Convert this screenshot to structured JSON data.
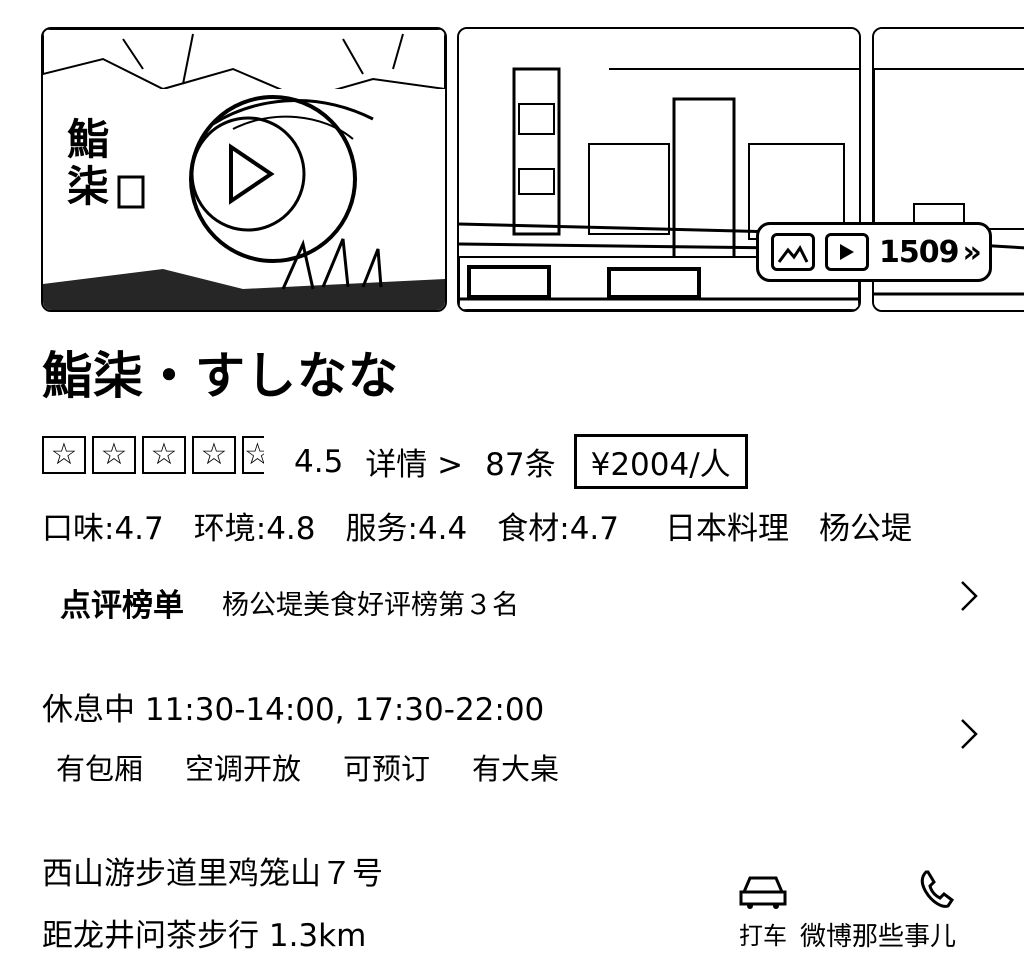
{
  "gallery": {
    "photo1_sign_text": "鮨柒",
    "media_count": "1509",
    "icons": [
      "image-icon",
      "video-icon",
      "chevron-right-icon",
      "play-icon"
    ]
  },
  "restaurant": {
    "name": "鮨柒・すしなな",
    "rating": {
      "stars": 4.5,
      "score": "4.5",
      "detail_link": "详情 >",
      "review_count": "87条"
    },
    "price_per_person": "¥2004/人",
    "scores": [
      "口味:4.7",
      "环境:4.8",
      "服务:4.4",
      "食材:4.7"
    ],
    "cuisine": "日本料理",
    "area": "杨公堤"
  },
  "ranking": {
    "title": "点评榜单",
    "text": "杨公堤美食好评榜第３名"
  },
  "hours": {
    "status_and_times": "休息中 11:30-14:00, 17:30-22:00",
    "tags": [
      "有包厢",
      "空调开放",
      "可预订",
      "有大桌"
    ]
  },
  "location": {
    "address": "西山游步道里鸡笼山７号",
    "distance": "距龙井问茶步行 1.3km"
  },
  "actions": {
    "taxi_label": "打车",
    "call_icon": "phone-icon"
  },
  "watermark": "微博那些事儿"
}
